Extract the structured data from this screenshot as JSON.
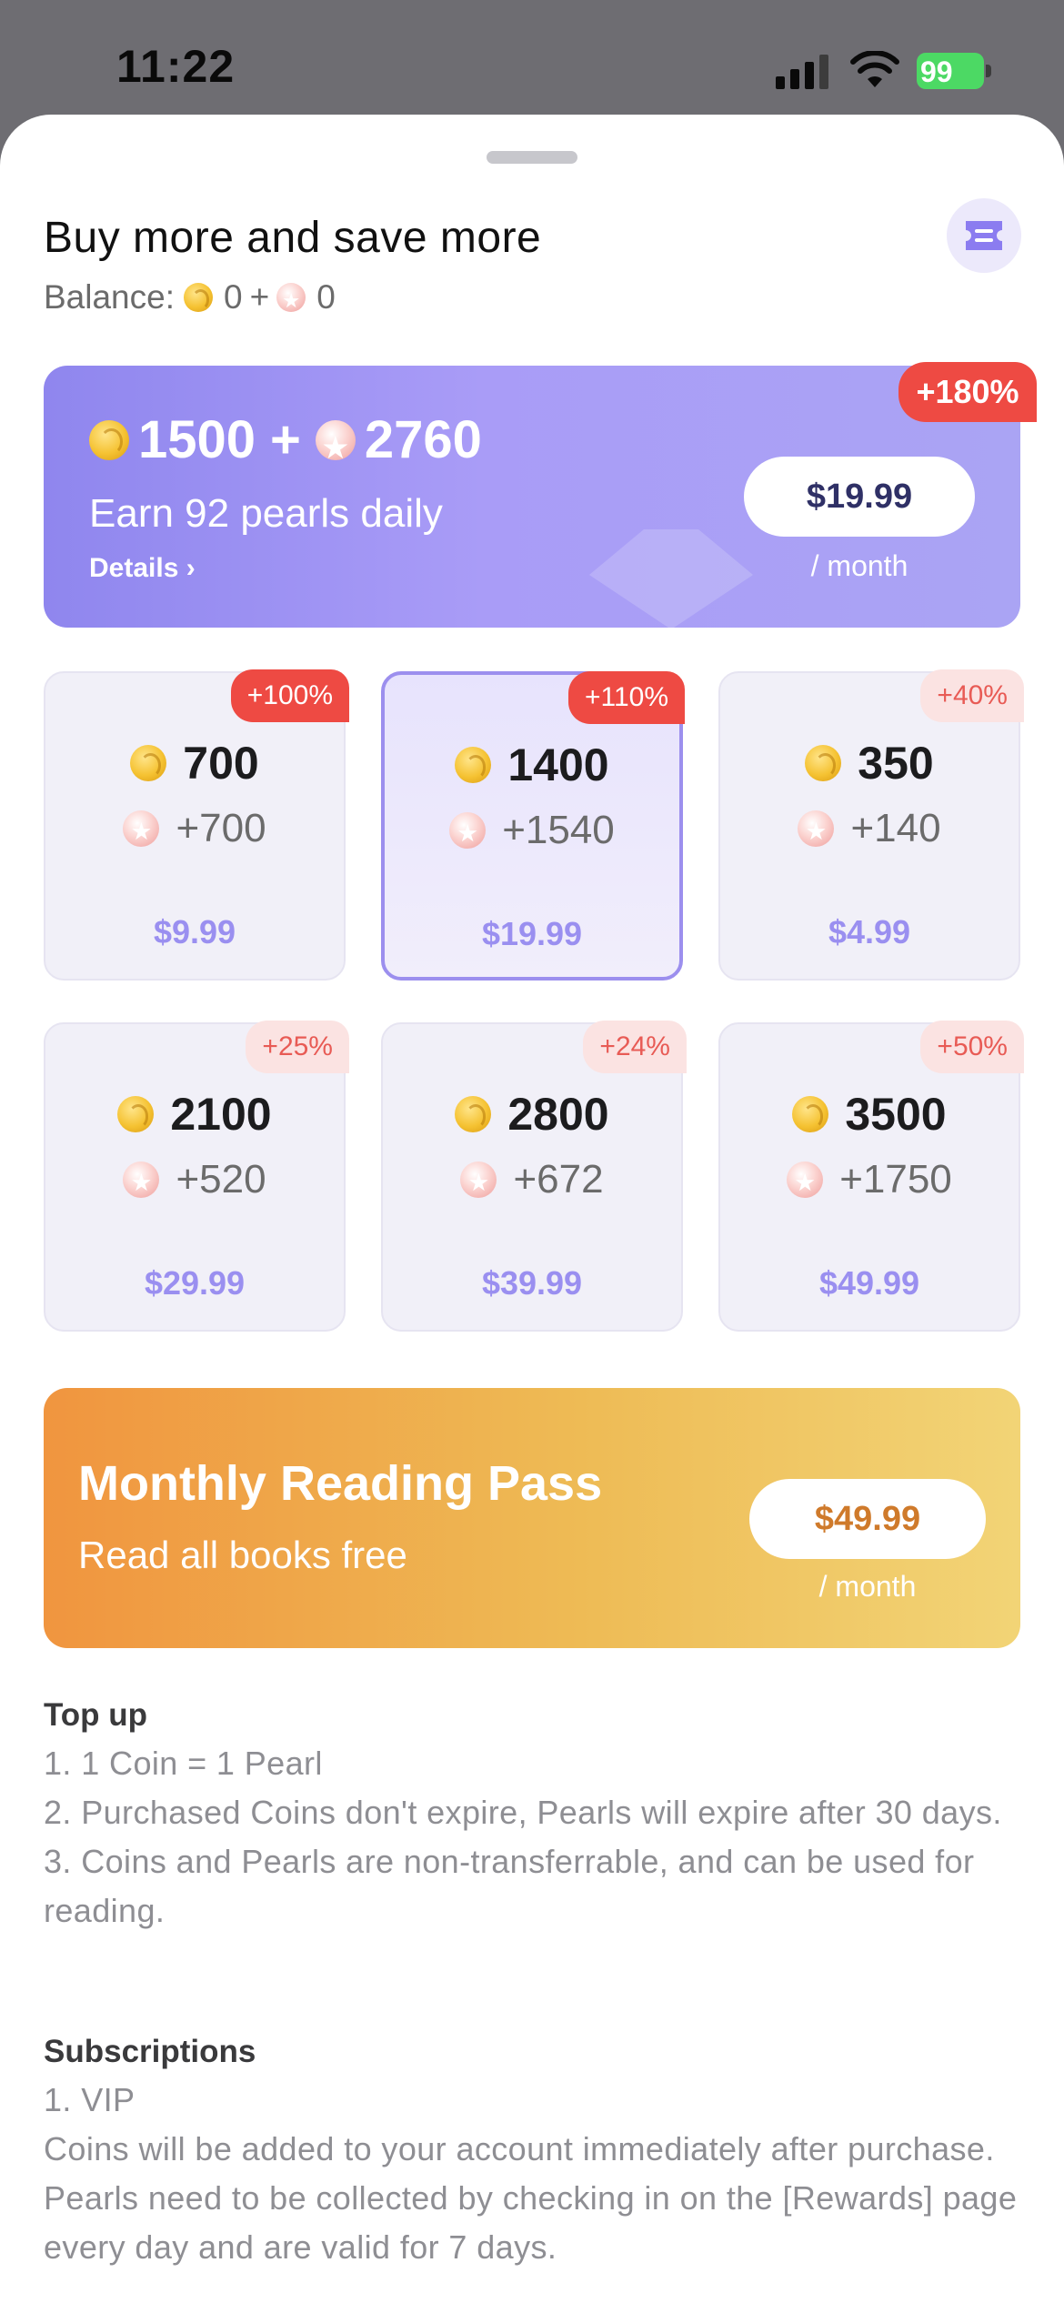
{
  "status_bar": {
    "time": "11:22",
    "battery": "99"
  },
  "header": {
    "title": "Buy more and save more",
    "balance_label": "Balance:",
    "coins": "0",
    "plus": "+",
    "pearls": "0"
  },
  "vip": {
    "coins": "1500",
    "plus": "+",
    "pearls": "2760",
    "daily": "Earn 92 pearls daily",
    "details": "Details ›",
    "price": "$19.99",
    "period": "/ month",
    "badge": "+180%"
  },
  "packages": [
    {
      "coins": "700",
      "pearls": "+700",
      "price": "$9.99",
      "badge": "+100%",
      "badge_style": "hot",
      "selected": false
    },
    {
      "coins": "1400",
      "pearls": "+1540",
      "price": "$19.99",
      "badge": "+110%",
      "badge_style": "hot",
      "selected": true
    },
    {
      "coins": "350",
      "pearls": "+140",
      "price": "$4.99",
      "badge": "+40%",
      "badge_style": "mild",
      "selected": false
    },
    {
      "coins": "2100",
      "pearls": "+520",
      "price": "$29.99",
      "badge": "+25%",
      "badge_style": "mild",
      "selected": false
    },
    {
      "coins": "2800",
      "pearls": "+672",
      "price": "$39.99",
      "badge": "+24%",
      "badge_style": "mild",
      "selected": false
    },
    {
      "coins": "3500",
      "pearls": "+1750",
      "price": "$49.99",
      "badge": "+50%",
      "badge_style": "mild",
      "selected": false
    }
  ],
  "pass": {
    "title": "Monthly Reading Pass",
    "subtitle": "Read all books free",
    "price": "$49.99",
    "period": "/ month"
  },
  "info": {
    "topup_heading": "Top up",
    "topup_lines": [
      "1. 1 Coin = 1 Pearl",
      "2. Purchased Coins don't expire, Pearls will expire after 30 days.",
      "3. Coins and Pearls are non-transferrable, and can be used for reading."
    ],
    "subs_heading": "Subscriptions",
    "subs_lines": [
      "1. VIP",
      "Coins will be added to your account immediately after purchase. Pearls need to be collected by checking in on the [Rewards] page every day and are valid for 7 days."
    ]
  },
  "colors": {
    "accent": "#9a8ff0",
    "badge_hot": "#ee4a43",
    "badge_mild": "#fbe3e2",
    "pass_orange": "#f0953f"
  }
}
